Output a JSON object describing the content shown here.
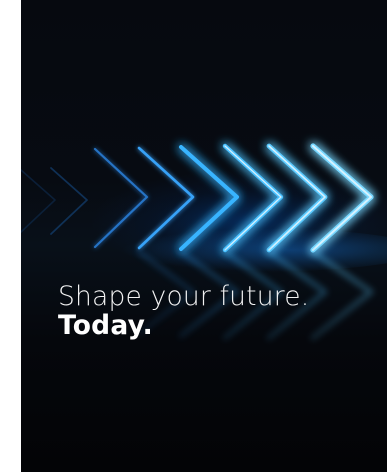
{
  "headline": {
    "line1": "Shape your future.",
    "line2": "Today."
  },
  "colors": {
    "background": "#05070c",
    "glow": "#1ea0ff",
    "glow_core": "#d9f3ff",
    "text": "#ffffff"
  },
  "graphic": {
    "name": "neon-chevron-arrows"
  }
}
